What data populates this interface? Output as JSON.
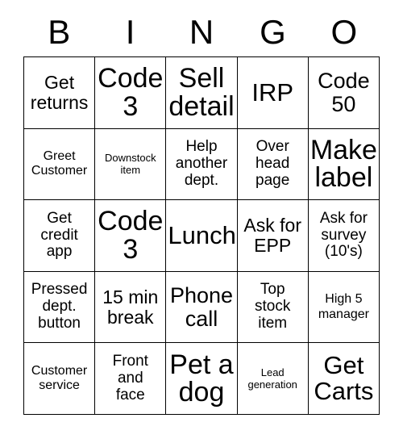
{
  "card": {
    "title": "BINGO",
    "headers": [
      "B",
      "I",
      "N",
      "G",
      "O"
    ],
    "rows": [
      [
        {
          "text": "Get\nreturns",
          "size": "sz-lg"
        },
        {
          "text": "Code\n3",
          "size": "sz-max"
        },
        {
          "text": "Sell\ndetail",
          "size": "sz-max"
        },
        {
          "text": "IRP",
          "size": "sz-xxl"
        },
        {
          "text": "Code\n50",
          "size": "sz-xl"
        }
      ],
      [
        {
          "text": "Greet\nCustomer",
          "size": "sz-sm"
        },
        {
          "text": "Downstock\nitem",
          "size": "sz-xs"
        },
        {
          "text": "Help\nanother\ndept.",
          "size": "sz-md"
        },
        {
          "text": "Over\nhead\npage",
          "size": "sz-md"
        },
        {
          "text": "Make\nlabel",
          "size": "sz-max"
        }
      ],
      [
        {
          "text": "Get\ncredit\napp",
          "size": "sz-md"
        },
        {
          "text": "Code\n3",
          "size": "sz-max"
        },
        {
          "text": "Lunch",
          "size": "sz-xxl"
        },
        {
          "text": "Ask for\nEPP",
          "size": "sz-lg"
        },
        {
          "text": "Ask for\nsurvey\n(10's)",
          "size": "sz-md"
        }
      ],
      [
        {
          "text": "Pressed\ndept.\nbutton",
          "size": "sz-md"
        },
        {
          "text": "15 min\nbreak",
          "size": "sz-lg"
        },
        {
          "text": "Phone\ncall",
          "size": "sz-xl"
        },
        {
          "text": "Top\nstock\nitem",
          "size": "sz-md"
        },
        {
          "text": "High 5\nmanager",
          "size": "sz-sm"
        }
      ],
      [
        {
          "text": "Customer\nservice",
          "size": "sz-sm"
        },
        {
          "text": "Front\nand\nface",
          "size": "sz-md"
        },
        {
          "text": "Pet a\ndog",
          "size": "sz-max"
        },
        {
          "text": "Lead\ngeneration",
          "size": "sz-xs"
        },
        {
          "text": "Get\nCarts",
          "size": "sz-xxl"
        }
      ]
    ]
  },
  "colors": {
    "background": "#ffffff",
    "text": "#000000",
    "grid_line": "#000000"
  }
}
